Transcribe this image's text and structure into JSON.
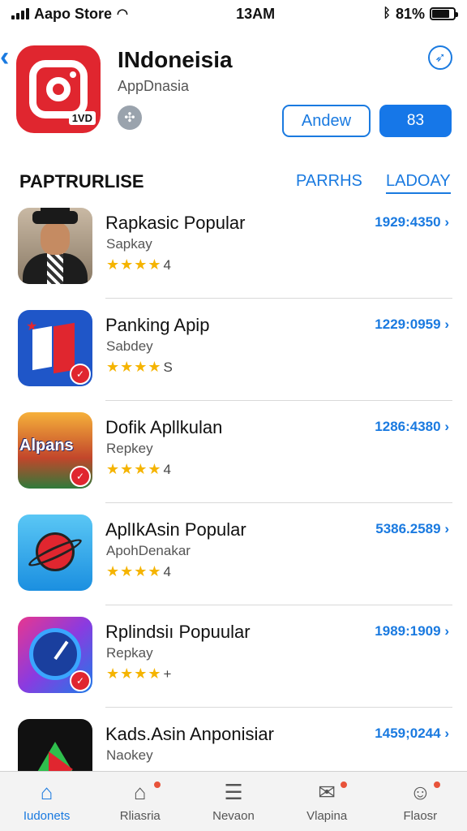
{
  "status_bar": {
    "carrier": "Aapo Store",
    "time": "13AM",
    "battery_percent": "81%"
  },
  "header": {
    "app_title": "INdoneisia",
    "app_subtitle": "AppDnasia",
    "app_icon_tag": "1VD",
    "outline_button": "Andew",
    "filled_button": "83"
  },
  "section": {
    "title": "PAPTRURLISE",
    "link_1": "PARRHS",
    "link_2": "LADOAY"
  },
  "apps": [
    {
      "name": "Rapkasic Popular",
      "dev": "Sapkay",
      "rating": "4",
      "count": "1929:4350"
    },
    {
      "name": "Panking Apip",
      "dev": "Sabdey",
      "rating": "S",
      "count": "1229:0959"
    },
    {
      "name": "Dofik Apllkulan",
      "dev": "Repkey",
      "rating": "4",
      "count": "1286:4380"
    },
    {
      "name": "AplIkAsin Popular",
      "dev": "ApohDenakar",
      "rating": "4",
      "count": "5386.2589"
    },
    {
      "name": "Rplindsiı Popuular",
      "dev": "Repkay",
      "rating": "+",
      "count": "1989:1909"
    },
    {
      "name": "Kads.Asin Anponisiar",
      "dev": "Naokey",
      "rating": "",
      "count": "1459;0244"
    }
  ],
  "thumb_text": {
    "app3": "Alpans"
  },
  "tabs": [
    {
      "label": "Iudonets",
      "icon": "home-icon"
    },
    {
      "label": "Rliasria",
      "icon": "house-notification-icon"
    },
    {
      "label": "Nevaon",
      "icon": "document-icon"
    },
    {
      "label": "Vlapina",
      "icon": "chat-icon"
    },
    {
      "label": "Flaosr",
      "icon": "profile-icon"
    }
  ],
  "colors": {
    "accent": "#1a7ae0",
    "brand_red": "#e0262f",
    "star": "#f5b400"
  }
}
